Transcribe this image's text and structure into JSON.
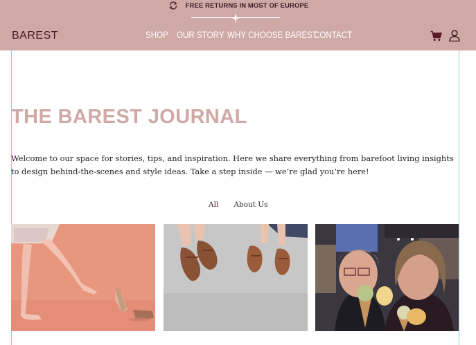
{
  "header": {
    "promo_icon": "refresh-icon",
    "promo_text": "FREE RETURNS IN MOST OF EUROPE",
    "logo": "BAREST",
    "nav": [
      {
        "label": "SHOP"
      },
      {
        "label": "OUR STORY"
      },
      {
        "label": "WHY CHOOSE BAREST"
      },
      {
        "label": "CONTACT"
      }
    ],
    "icons": [
      "cart-icon",
      "user-icon"
    ],
    "background_color": "#cfa9a6"
  },
  "main": {
    "title": "THE BAREST JOURNAL",
    "intro": "Welcome to our space for stories, tips, and inspiration. Here we share everything from barefoot living insights to design behind-the-scenes and style ideas. Take a step inside — we’re glad you’re here!",
    "filters": [
      {
        "label": "All",
        "active": true
      },
      {
        "label": "About Us",
        "active": false
      }
    ],
    "title_color": "#cfa9a6"
  }
}
